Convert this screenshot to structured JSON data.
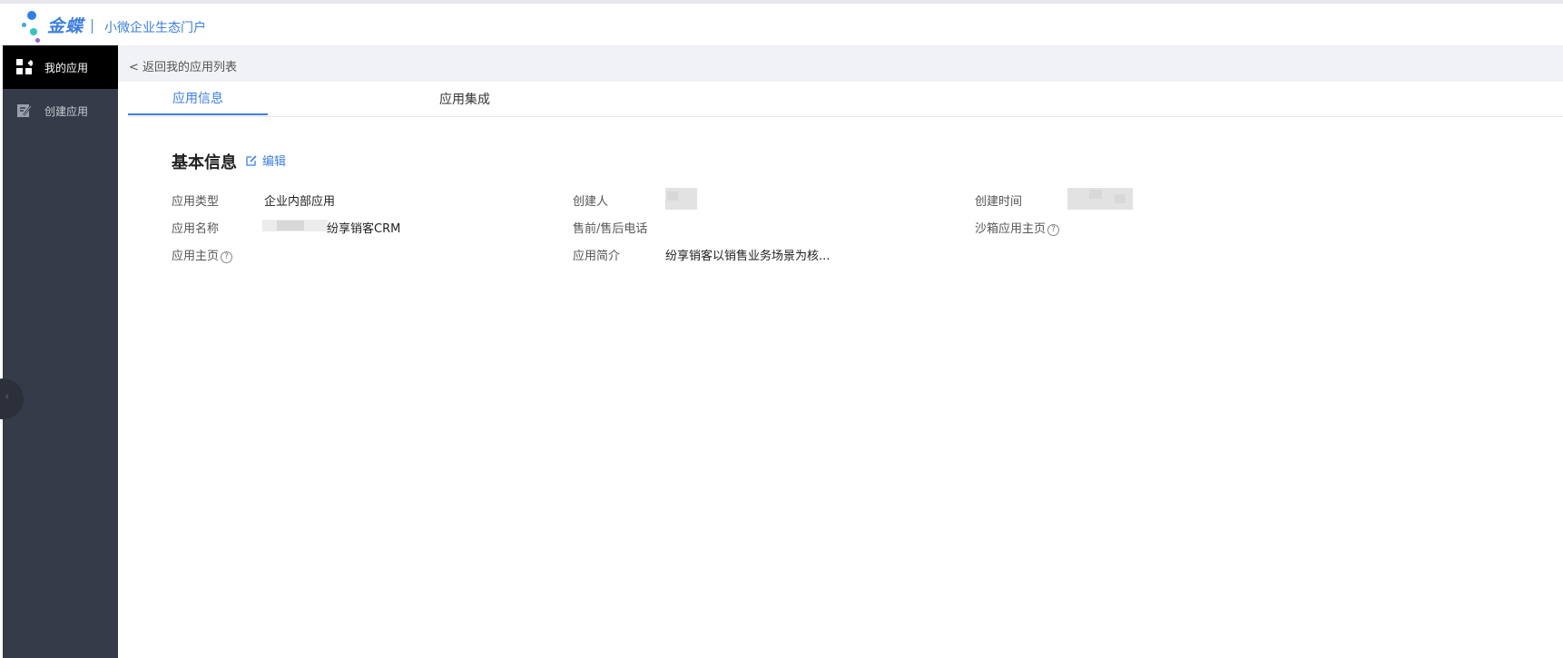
{
  "header": {
    "brand": "金蝶",
    "portal_name": "小微企业生态门户"
  },
  "sidebar": {
    "items": [
      {
        "label": "我的应用",
        "icon": "apps-grid-icon",
        "active": true
      },
      {
        "label": "创建应用",
        "icon": "edit-doc-icon",
        "active": false
      }
    ],
    "collapse_arrow": "‹"
  },
  "back_link": "< 返回我的应用列表",
  "tabs": [
    {
      "label": "应用信息",
      "active": true
    },
    {
      "label": "应用集成",
      "active": false
    }
  ],
  "section": {
    "title": "基本信息",
    "edit_label": "编辑"
  },
  "info": {
    "type_label": "应用类型",
    "type_value": "企业内部应用",
    "creator_label": "创建人",
    "created_time_label": "创建时间",
    "name_label": "应用名称",
    "name_value": "纷享销客CRM",
    "phone_label": "售前/售后电话",
    "sandbox_label": "沙箱应用主页",
    "homepage_label": "应用主页",
    "desc_label": "应用简介",
    "desc_value": "纷享销客以销售业务场景为核..."
  },
  "help_glyph": "?",
  "colors": {
    "accent": "#3b7ded",
    "sidebar_bg": "#353b48",
    "sidebar_active_bg": "#000000",
    "backbar_bg": "#f0f2f5"
  }
}
